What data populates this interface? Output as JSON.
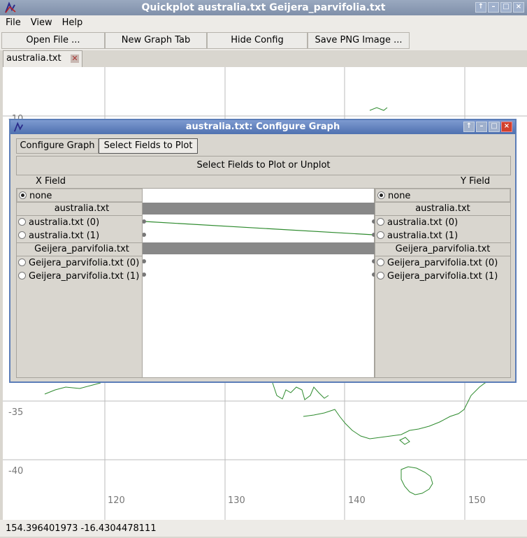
{
  "window": {
    "title": "Quickplot australia.txt Geijera_parvifolia.txt"
  },
  "menu": [
    "File",
    "View",
    "Help"
  ],
  "toolbar": {
    "open_file": "Open File ...",
    "new_graph_tab": "New Graph Tab",
    "hide_config": "Hide Config",
    "save_png": "Save PNG Image ..."
  },
  "tabs": [
    {
      "label": "australia.txt"
    }
  ],
  "plot": {
    "x_ticks": [
      "120",
      "130",
      "140",
      "150"
    ],
    "y_ticks": [
      "-10",
      "-35",
      "-40"
    ],
    "line_color": "#2e8b2e"
  },
  "dialog": {
    "title": "australia.txt: Configure Graph",
    "tabs": [
      "Configure Graph",
      "Select Fields to Plot"
    ],
    "active_tab": 1,
    "heading": "Select Fields to Plot or Unplot",
    "x_label": "X Field",
    "y_label": "Y Field",
    "x_fields": {
      "none": "none",
      "group1": "australia.txt",
      "g1_items": [
        "australia.txt (0)",
        "australia.txt (1)"
      ],
      "group2": "Geijera_parvifolia.txt",
      "g2_items": [
        "Geijera_parvifolia.txt (0)",
        "Geijera_parvifolia.txt (1)"
      ]
    },
    "y_fields": {
      "none": "none",
      "group1": "australia.txt",
      "g1_items": [
        "australia.txt (0)",
        "australia.txt (1)"
      ],
      "group2": "Geijera_parvifolia.txt",
      "g2_items": [
        "Geijera_parvifolia.txt (0)",
        "Geijera_parvifolia.txt (1)"
      ]
    }
  },
  "status": {
    "coords": "154.396401973  -16.4304478111"
  }
}
